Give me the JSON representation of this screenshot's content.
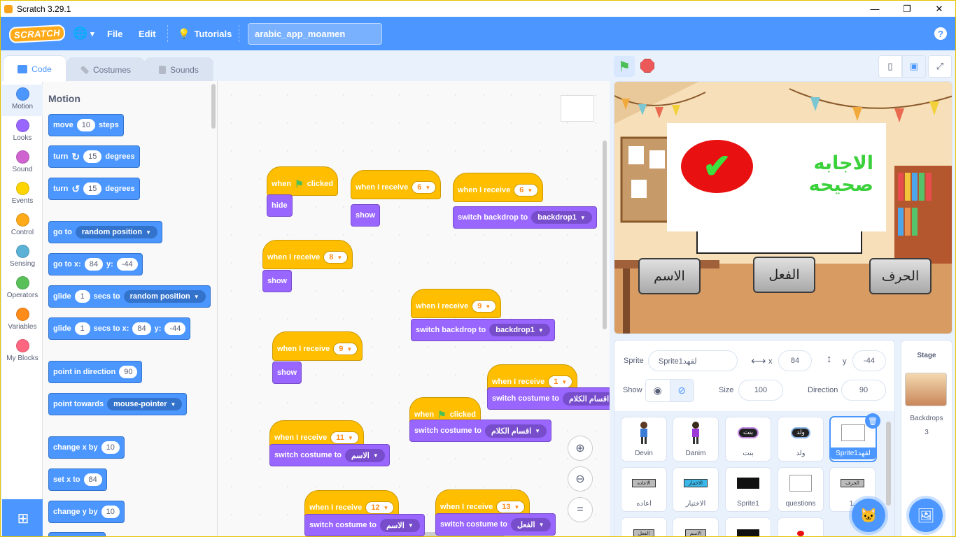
{
  "window": {
    "title": "Scratch 3.29.1",
    "minimize": "—",
    "maximize": "❐",
    "close": "✕"
  },
  "menubar": {
    "logo": "SCRATCH",
    "globe": "🌐",
    "globe_caret": "▾",
    "file": "File",
    "edit": "Edit",
    "tutorials": "Tutorials",
    "tutorials_icon": "💡",
    "project_title": "arabic_app_moamen",
    "help": "?"
  },
  "tabs": {
    "code": "Code",
    "costumes": "Costumes",
    "sounds": "Sounds"
  },
  "categories": [
    {
      "label": "Motion",
      "color": "#4c97ff"
    },
    {
      "label": "Looks",
      "color": "#9966ff"
    },
    {
      "label": "Sound",
      "color": "#cf63cf"
    },
    {
      "label": "Events",
      "color": "#ffd500"
    },
    {
      "label": "Control",
      "color": "#ffab19"
    },
    {
      "label": "Sensing",
      "color": "#5cb1d6"
    },
    {
      "label": "Operators",
      "color": "#59c059"
    },
    {
      "label": "Variables",
      "color": "#ff8c1a"
    },
    {
      "label": "My Blocks",
      "color": "#ff6680"
    }
  ],
  "flyout": {
    "title": "Motion",
    "move": {
      "a": "move",
      "v": "10",
      "b": "steps"
    },
    "turn_right": {
      "a": "turn",
      "icon": "↻",
      "v": "15",
      "b": "degrees"
    },
    "turn_left": {
      "a": "turn",
      "icon": "↺",
      "v": "15",
      "b": "degrees"
    },
    "goto": {
      "a": "go to",
      "d": "random position"
    },
    "gotoxy": {
      "a": "go to x:",
      "x": "84",
      "b": "y:",
      "y": "-44"
    },
    "glide1": {
      "a": "glide",
      "v": "1",
      "b": "secs to",
      "d": "random position"
    },
    "glide2": {
      "a": "glide",
      "v": "1",
      "b": "secs to x:",
      "x": "84",
      "c": "y:",
      "y": "-44"
    },
    "point": {
      "a": "point in direction",
      "v": "90"
    },
    "towards": {
      "a": "point towards",
      "d": "mouse-pointer"
    },
    "changex": {
      "a": "change x by",
      "v": "10"
    },
    "setx": {
      "a": "set x to",
      "v": "84"
    },
    "changey": {
      "a": "change y by",
      "v": "10"
    }
  },
  "scripts": {
    "when": "when",
    "clicked": "clicked",
    "when_receive": "when I receive",
    "hide": "hide",
    "show": "show",
    "switch_backdrop": "switch backdrop to",
    "switch_costume": "switch costume to",
    "backdrop1": "backdrop1",
    "n6": "6",
    "n8": "8",
    "n9": "9",
    "n1": "1",
    "n11": "11",
    "n12": "12",
    "n13": "13",
    "c_kalam": "اقسام الكلام",
    "c_ism": "الاسم",
    "c_fiel": "الفعل"
  },
  "stage": {
    "correct_text": "الاجابه صحيحه",
    "tick": "✔",
    "btn_ism": "الاسم",
    "btn_fiel": "الفعل",
    "btn_harf": "الحرف"
  },
  "sprite_info": {
    "sprite_label": "Sprite",
    "sprite_name": "Sprite1لقهد",
    "x_label": "x",
    "x": "84",
    "y_label": "y",
    "y": "-44",
    "show_label": "Show",
    "size_label": "Size",
    "size": "100",
    "direction_label": "Direction",
    "direction": "90"
  },
  "sprites": [
    {
      "name": "Devin"
    },
    {
      "name": "Danim"
    },
    {
      "name": "بنت"
    },
    {
      "name": "ولد"
    },
    {
      "name": "Sprite1لقهد"
    },
    {
      "name": "اعاده"
    },
    {
      "name": "الاختبار"
    },
    {
      "name": "Sprite1"
    },
    {
      "name": "questions"
    },
    {
      "name": "1ـ"
    }
  ],
  "thumb_text": {
    "bint": "بنت",
    "walad": "ولد",
    "iada": "الاعاده",
    "ikhtibar": "الاختبار",
    "harf": "الحرف",
    "fiel": "الفعل",
    "ism": "الاسم"
  },
  "stage_panel": {
    "title": "Stage",
    "backdrops_label": "Backdrops",
    "backdrops_count": "3"
  },
  "colors": {
    "accent": "#4c97ff",
    "motion": "#4c97ff",
    "looks": "#9966ff",
    "events": "#ffbf00"
  }
}
